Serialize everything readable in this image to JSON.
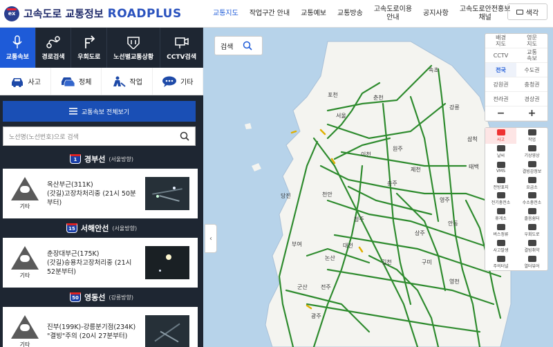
{
  "header": {
    "logo_badge": "ex",
    "logo_ko": "고속도로 교통정보",
    "logo_en": "ROADPLUS",
    "nav": [
      "교통지도",
      "작업구간 안내",
      "교통예보",
      "교통방송",
      "고속도로이용\n안내",
      "공지사항",
      "고속도로안전홍보\n채널"
    ],
    "color_button": "색각"
  },
  "sidebar": {
    "tabs": [
      {
        "label": "교통속보",
        "icon": "mic-icon"
      },
      {
        "label": "경로검색",
        "icon": "route-icon"
      },
      {
        "label": "우회도로",
        "icon": "detour-icon"
      },
      {
        "label": "노선별교통상황",
        "icon": "road-route-icon"
      },
      {
        "label": "CCTV검색",
        "icon": "cctv-icon"
      }
    ],
    "filters": [
      {
        "label": "사고",
        "icon": "car-crash-icon"
      },
      {
        "label": "정체",
        "icon": "traffic-jam-icon"
      },
      {
        "label": "작업",
        "icon": "worker-icon"
      },
      {
        "label": "기타",
        "icon": "speech-bubble-icon"
      }
    ],
    "all_view_label": "교통속보 전체보기",
    "search_placeholder": "노선명(노선번호)으로 검색",
    "roads": [
      {
        "number": "1",
        "name": "경부선",
        "direction": "(서울방향)",
        "type_label": "기타",
        "text": "옥산부근(311K)\n(갓길)고장차처리중 (21시 50분\n부터)"
      },
      {
        "number": "15",
        "name": "서해안선",
        "direction": "(서울방향)",
        "type_label": "기타",
        "text": "춘장대부근(175K)\n(갓길)승용차고장처리중 (21시\n52분부터)"
      },
      {
        "number": "50",
        "name": "영동선",
        "direction": "(강릉방향)",
        "type_label": "기타",
        "text": "진부(199K)-강릉분기점(234K)\n\"결빙\"주의 (20시 27분부터)"
      }
    ]
  },
  "map": {
    "search_label": "검색",
    "cities": [
      "속초",
      "포천",
      "춘천",
      "강릉",
      "삼척",
      "서울",
      "이천",
      "원주",
      "태백",
      "제천",
      "당진",
      "천안",
      "충주",
      "영주",
      "청주",
      "안동",
      "부여",
      "대전",
      "상주",
      "김천",
      "구미",
      "논산",
      "영천",
      "전주",
      "군산",
      "광주"
    ],
    "controls": [
      {
        "label": "배경\n지도",
        "active": false
      },
      {
        "label": "영문\n지도",
        "active": false
      },
      {
        "label": "CCTV",
        "active": false
      },
      {
        "label": "교통\n속보",
        "active": false
      },
      {
        "label": "전국",
        "active": true
      },
      {
        "label": "수도권",
        "active": false
      },
      {
        "label": "강원권",
        "active": false
      },
      {
        "label": "충청권",
        "active": false
      },
      {
        "label": "전라권",
        "active": false
      },
      {
        "label": "경상권",
        "active": false
      },
      {
        "label": "−",
        "active": false
      },
      {
        "label": "+",
        "active": false
      }
    ],
    "layers": [
      {
        "label": "사고",
        "active": true
      },
      {
        "label": "작업",
        "active": false
      },
      {
        "label": "날씨",
        "active": false
      },
      {
        "label": "기상영상",
        "active": false
      },
      {
        "label": "VMS",
        "active": false
      },
      {
        "label": "결빙감정보",
        "active": false
      },
      {
        "label": "전방표지",
        "active": false
      },
      {
        "label": "요금소",
        "active": false
      },
      {
        "label": "전기충전소",
        "active": false
      },
      {
        "label": "수소충전소",
        "active": false
      },
      {
        "label": "휴게소",
        "active": false
      },
      {
        "label": "졸음쉼터",
        "active": false
      },
      {
        "label": "버스정류",
        "active": false
      },
      {
        "label": "우회도로",
        "active": false
      },
      {
        "label": "사고발생",
        "active": false
      },
      {
        "label": "결빙취약",
        "active": false
      },
      {
        "label": "주의터널",
        "active": false
      },
      {
        "label": "열터뷰어",
        "active": false
      }
    ]
  }
}
